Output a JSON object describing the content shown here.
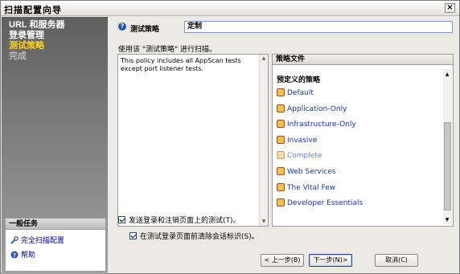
{
  "window": {
    "title": "扫描配置向导",
    "close_label": "×"
  },
  "sidebar": {
    "steps": [
      {
        "label": "URL 和服务器",
        "state": "done"
      },
      {
        "label": "登录管理",
        "state": "done"
      },
      {
        "label": "测试策略",
        "state": "current"
      },
      {
        "label": "完成",
        "state": "future"
      }
    ],
    "tasks": {
      "header": "一般任务",
      "items": [
        {
          "label": "完全扫描配置",
          "icon": "wrench-icon"
        },
        {
          "label": "帮助",
          "icon": "help-icon"
        }
      ]
    }
  },
  "main": {
    "policy_field_label": "测试策略",
    "policy_field_value": "定制",
    "hint": "使用该 \"测试策略\" 进行扫描。",
    "description": "This policy includes all AppScan tests except port listener tests.",
    "policy_panel": {
      "header": "策略文件",
      "group": "预定义的策略",
      "items": [
        {
          "label": "Default",
          "disabled": false
        },
        {
          "label": "Application-Only",
          "disabled": false
        },
        {
          "label": "Infrastructure-Only",
          "disabled": false
        },
        {
          "label": "Invasive",
          "disabled": false
        },
        {
          "label": "Complete",
          "disabled": true
        },
        {
          "label": "Web Services",
          "disabled": false
        },
        {
          "label": "The Vital Few",
          "disabled": false
        },
        {
          "label": "Developer Essentials",
          "disabled": false
        }
      ]
    },
    "checkbox_1": "发送登录和注销页面上的测试(T)。",
    "checkbox_2": "在测试登录页面前清除会话标识(S)。",
    "buttons": {
      "back": "< 上一步(B)",
      "next": "下一步(N)>",
      "cancel": "取消(C)"
    }
  }
}
